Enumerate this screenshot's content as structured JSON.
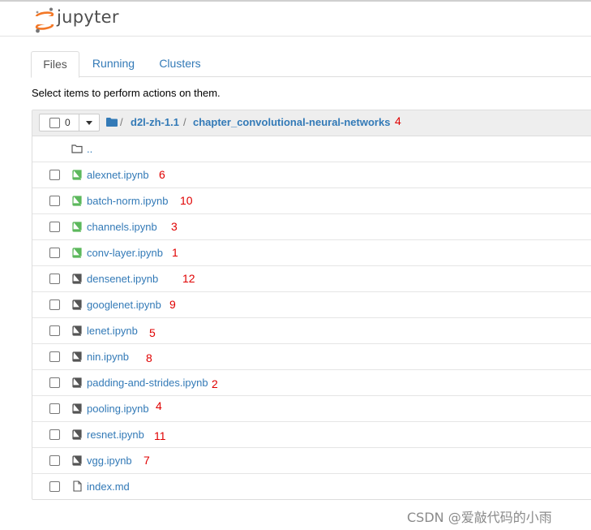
{
  "app": {
    "logo_text": "jupyter"
  },
  "tabs": [
    {
      "label": "Files",
      "active": true
    },
    {
      "label": "Running",
      "active": false
    },
    {
      "label": "Clusters",
      "active": false
    }
  ],
  "toolbar": {
    "hint": "Select items to perform actions on them.",
    "selected_count": "0"
  },
  "breadcrumb": {
    "sep1": "/",
    "parent": "d2l-zh-1.1",
    "sep2": "/",
    "current": "chapter_convolutional-neural-networks"
  },
  "files": {
    "updir": "..",
    "items": [
      {
        "name": "alexnet.ipynb",
        "type": "notebook-running"
      },
      {
        "name": "batch-norm.ipynb",
        "type": "notebook-running"
      },
      {
        "name": "channels.ipynb",
        "type": "notebook-running"
      },
      {
        "name": "conv-layer.ipynb",
        "type": "notebook-running"
      },
      {
        "name": "densenet.ipynb",
        "type": "notebook"
      },
      {
        "name": "googlenet.ipynb",
        "type": "notebook"
      },
      {
        "name": "lenet.ipynb",
        "type": "notebook"
      },
      {
        "name": "nin.ipynb",
        "type": "notebook"
      },
      {
        "name": "padding-and-strides.ipynb",
        "type": "notebook"
      },
      {
        "name": "pooling.ipynb",
        "type": "notebook"
      },
      {
        "name": "resnet.ipynb",
        "type": "notebook"
      },
      {
        "name": "vgg.ipynb",
        "type": "notebook"
      },
      {
        "name": "index.md",
        "type": "file"
      }
    ]
  },
  "annotations": {
    "breadcrumb": "4",
    "alexnet": "6",
    "batch_norm": "10",
    "channels": "3",
    "conv_layer": "1",
    "densenet": "12",
    "googlenet": "9",
    "lenet": "5",
    "nin": "8",
    "padding": "2",
    "pooling": "4",
    "resnet": "11",
    "vgg": "7"
  },
  "colors": {
    "link": "#337ab7",
    "running_notebook": "#5cb85c",
    "notebook": "#555555",
    "annotation": "#e00000",
    "logo_orange": "#f37726"
  },
  "watermark": "CSDN @爱敲代码的小雨"
}
